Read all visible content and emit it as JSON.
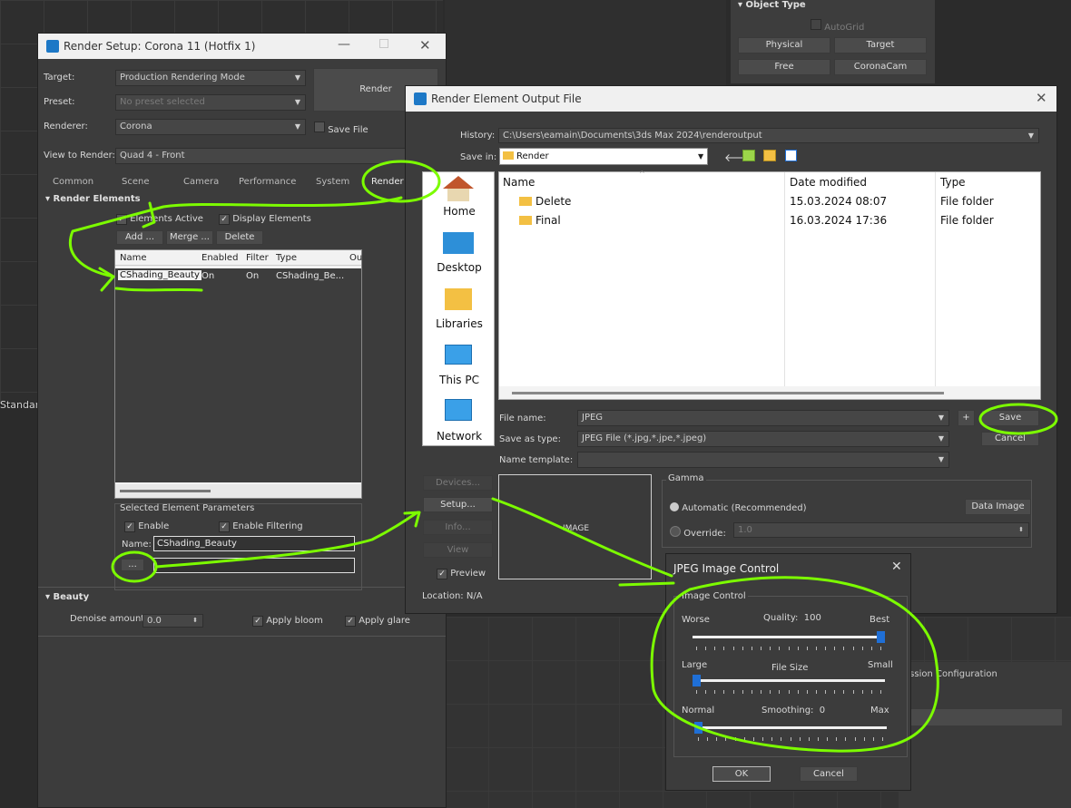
{
  "background_panel": {
    "object_type_header": "Object Type",
    "autogrid_label": "AutoGrid",
    "buttons": [
      "Physical",
      "Target",
      "Free",
      "CoronaCam"
    ],
    "standard_label": "Standard",
    "session_tab": "ession Configuration"
  },
  "render_setup": {
    "title": "Render Setup: Corona 11 (Hotfix 1)",
    "target_label": "Target:",
    "target_value": "Production Rendering Mode",
    "preset_label": "Preset:",
    "preset_value": "No preset selected",
    "renderer_label": "Renderer:",
    "renderer_value": "Corona",
    "save_file_label": "Save File",
    "render_button": "Render",
    "view_label": "View to Render:",
    "view_value": "Quad 4 - Front",
    "tabs": [
      "Common",
      "Scene",
      "Camera",
      "Performance",
      "System",
      "Render E"
    ],
    "render_elements_header": "Render Elements",
    "elements_active": "Elements Active",
    "display_elements": "Display Elements",
    "add_button": "Add ...",
    "merge_button": "Merge ...",
    "delete_button": "Delete",
    "table_headers": [
      "Name",
      "Enabled",
      "Filter",
      "Type",
      "Ou"
    ],
    "table_row": [
      "CShading_Beauty",
      "On",
      "On",
      "CShading_Be..."
    ],
    "selected_params_header": "Selected Element Parameters",
    "enable_label": "Enable",
    "enable_filtering_label": "Enable Filtering",
    "name_label": "Name:",
    "name_value": "CShading_Beauty",
    "browse_button": "...",
    "beauty_header": "Beauty",
    "denoise_label": "Denoise amount:",
    "denoise_value": "0.0",
    "apply_bloom": "Apply bloom",
    "apply_glare": "Apply glare"
  },
  "output_file": {
    "title": "Render Element Output File",
    "history_label": "History:",
    "history_value": "C:\\Users\\eamain\\Documents\\3ds Max 2024\\renderoutput",
    "save_in_label": "Save in:",
    "save_in_value": "Render",
    "sidebar": [
      "Home",
      "Desktop",
      "Libraries",
      "This PC",
      "Network"
    ],
    "columns": [
      "Name",
      "Date modified",
      "Type"
    ],
    "rows": [
      {
        "name": "Delete",
        "date": "15.03.2024 08:07",
        "type": "File folder"
      },
      {
        "name": "Final",
        "date": "16.03.2024 17:36",
        "type": "File folder"
      }
    ],
    "file_name_label": "File name:",
    "file_name_value": "JPEG",
    "plus_button": "+",
    "save_button": "Save",
    "save_as_type_label": "Save as type:",
    "save_as_type_value": "JPEG File (*.jpg,*.jpe,*.jpeg)",
    "cancel_button": "Cancel",
    "name_template_label": "Name template:",
    "devices_button": "Devices...",
    "setup_button": "Setup...",
    "info_button": "Info...",
    "view_button": "View",
    "preview_label": "Preview",
    "image_label": "IMAGE",
    "location_label": "Location:",
    "location_value": "N/A",
    "gamma_header": "Gamma",
    "automatic_label": "Automatic (Recommended)",
    "override_label": "Override:",
    "override_value": "1.0",
    "data_image_button": "Data Image"
  },
  "jpeg_control": {
    "title": "JPEG Image Control",
    "group_label": "Image Control",
    "worse": "Worse",
    "quality_label": "Quality:",
    "quality_value": "100",
    "best": "Best",
    "quality_level": 1.0,
    "large": "Large",
    "file_size_label": "File Size",
    "small": "Small",
    "file_size_level": 0.0,
    "normal": "Normal",
    "smoothing_label": "Smoothing:",
    "smoothing_value": "0",
    "max": "Max",
    "smoothing_level": 0.0,
    "ok_button": "OK",
    "cancel_button": "Cancel"
  },
  "colors": {
    "annotation": "#7CFC00",
    "slider_thumb": "#1f6fd6",
    "folder": "#f3c043"
  }
}
